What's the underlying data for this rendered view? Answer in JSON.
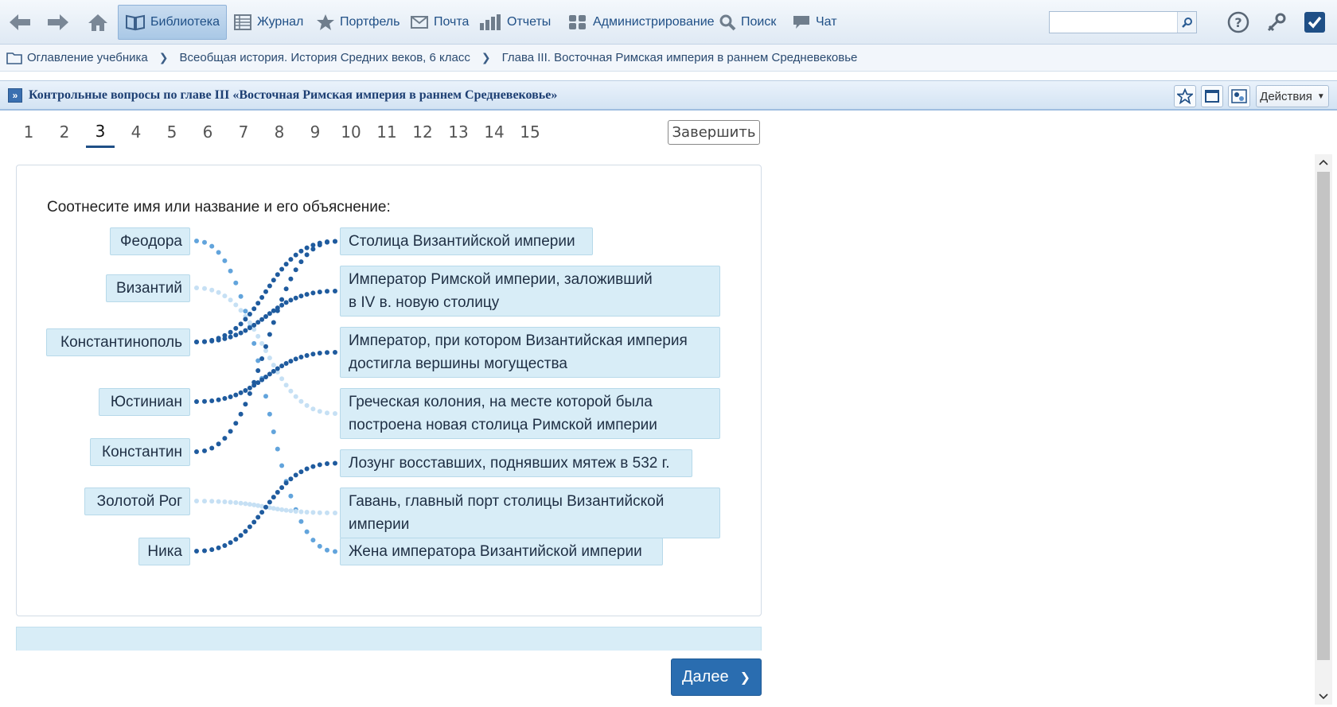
{
  "toolbar": {
    "back_icon": "arrow-left-icon",
    "forward_icon": "arrow-right-icon",
    "home_icon": "home-icon",
    "items": [
      {
        "label": "Библиотека",
        "icon": "book-icon",
        "active": true
      },
      {
        "label": "Журнал",
        "icon": "table-icon"
      },
      {
        "label": "Портфель",
        "icon": "star-icon"
      },
      {
        "label": "Почта",
        "icon": "envelope-icon"
      },
      {
        "label": "Отчеты",
        "icon": "bar-chart-icon"
      },
      {
        "label": "Администрирование",
        "icon": "users-icon"
      },
      {
        "label": "Поиск",
        "icon": "magnifier-icon"
      },
      {
        "label": "Чат",
        "icon": "speech-bubble-icon"
      }
    ],
    "search_value": "",
    "right_icons": [
      "help-icon",
      "key-icon",
      "checkbox-icon"
    ]
  },
  "breadcrumb": {
    "items": [
      "Оглавление учебника",
      "Всеобщая история. История Средних веков, 6 класс",
      "Глава III. Восточная Римская империя в раннем Средневековье"
    ]
  },
  "section": {
    "title": "Контрольные вопросы по главе III «Восточная Римская империя в раннем Средневековье»",
    "actions_label": "Действия"
  },
  "pager": {
    "pages": [
      "1",
      "2",
      "3",
      "4",
      "5",
      "6",
      "7",
      "8",
      "9",
      "10",
      "11",
      "12",
      "13",
      "14",
      "15"
    ],
    "current": "3",
    "finish_label": "Завершить"
  },
  "question": {
    "prompt": "Соотнесите имя или название и его объяснение:",
    "left": [
      "Феодора",
      "Византий",
      "Константинополь",
      "Юстиниан",
      "Константин",
      "Золотой Рог",
      "Ника"
    ],
    "right": [
      {
        "line1": "Столица Византийской империи",
        "line2": ""
      },
      {
        "line1": "Император Римской империи, заложивший",
        "line2": "в IV в. новую столицу"
      },
      {
        "line1": "Император, при котором Византийская империя",
        "line2": "достигла вершины могущества"
      },
      {
        "line1": "Греческая колония, на месте которой была",
        "line2": "построена новая столица Римской империи"
      },
      {
        "line1": "Лозунг восставших, поднявших мятеж в 532 г.",
        "line2": ""
      },
      {
        "line1": "Гавань, главный порт столицы Византийской",
        "line2": "империи"
      },
      {
        "line1": "Жена императора Византийской империи",
        "line2": ""
      }
    ],
    "links": [
      {
        "from": 0,
        "to": 6,
        "color": "#62a4dc"
      },
      {
        "from": 1,
        "to": 3,
        "color": "#c6e0f4"
      },
      {
        "from": 2,
        "to": 0,
        "color": "#1f5b9e"
      },
      {
        "from": 2,
        "to": 1,
        "color": "#1f5b9e"
      },
      {
        "from": 3,
        "to": 2,
        "color": "#1f5b9e"
      },
      {
        "from": 4,
        "to": 0,
        "color": "#1f5b9e"
      },
      {
        "from": 5,
        "to": 5,
        "color": "#c6e0f4"
      },
      {
        "from": 6,
        "to": 4,
        "color": "#1f5b9e"
      }
    ]
  },
  "next_label": "Далее"
}
